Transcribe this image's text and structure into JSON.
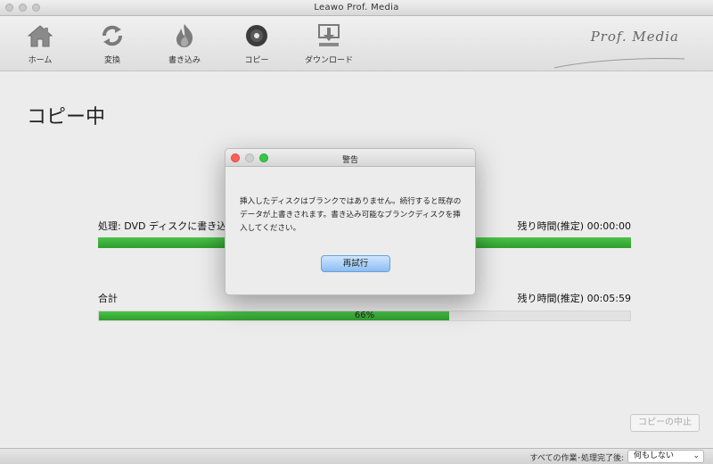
{
  "window": {
    "title": "Leawo Prof. Media"
  },
  "toolbar": {
    "items": [
      {
        "label": "ホーム",
        "icon": "home-icon"
      },
      {
        "label": "変換",
        "icon": "convert-icon"
      },
      {
        "label": "書き込み",
        "icon": "burn-icon"
      },
      {
        "label": "コピー",
        "icon": "disc-icon"
      },
      {
        "label": "ダウンロード",
        "icon": "download-icon"
      }
    ],
    "brand": "Prof. Media"
  },
  "main": {
    "title": "コピー中",
    "process": {
      "label": "処理: DVD ディスクに書き込み",
      "remaining": "残り時間(推定) 00:00:00",
      "progress": 1.0
    },
    "total": {
      "label": "合計",
      "remaining": "残り時間(推定) 00:05:59",
      "progress": 0.66,
      "percent_text": "66%"
    },
    "stop_button": "コピーの中止"
  },
  "dialog": {
    "title": "警告",
    "message": "挿入したディスクはブランクではありません。続行すると既存のデータが上書きされます。書き込み可能なブランクディスクを挿入してください。",
    "retry_button": "再試行"
  },
  "statusbar": {
    "label": "すべての作業･処理完了後:",
    "select_value": "何もしない"
  },
  "colors": {
    "progress_green": "#3bb13a",
    "retry_blue": "#9cc8f5"
  }
}
